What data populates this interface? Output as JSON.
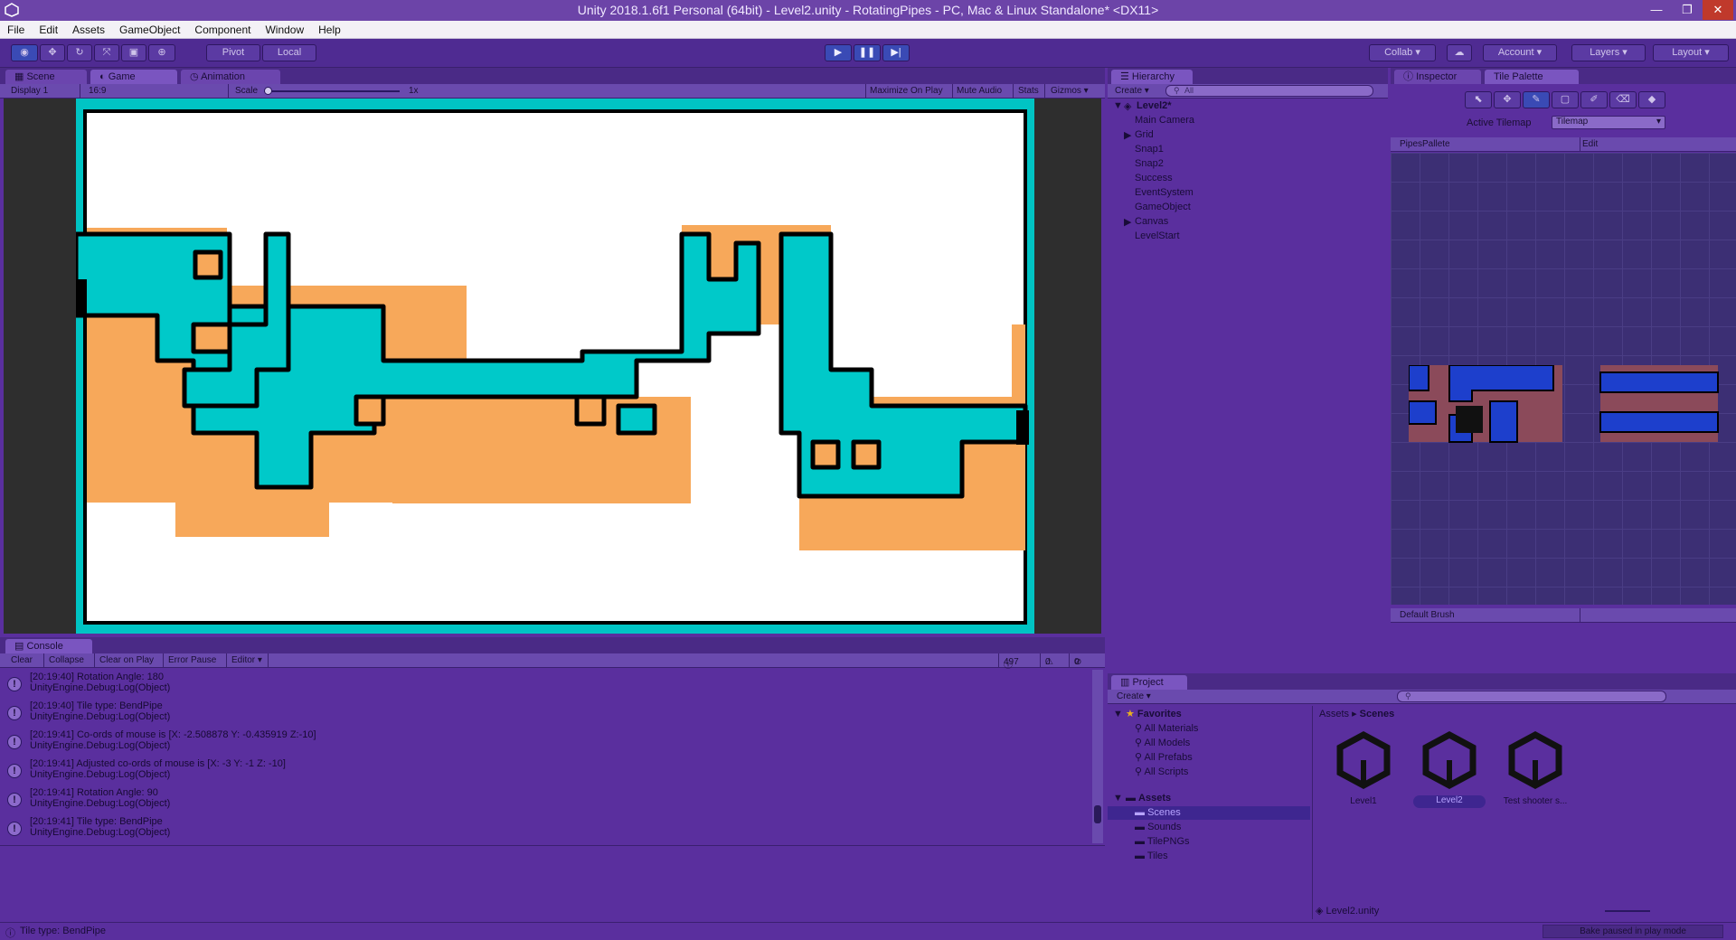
{
  "window": {
    "title": "Unity 2018.1.6f1 Personal (64bit) - Level2.unity - RotatingPipes - PC, Mac & Linux Standalone* <DX11>",
    "controls": [
      "—",
      "❐",
      "✕"
    ]
  },
  "menu": [
    "File",
    "Edit",
    "Assets",
    "GameObject",
    "Component",
    "Window",
    "Help"
  ],
  "toolbar": {
    "pivot": "Pivot",
    "local": "Local",
    "collab": "Collab ▾",
    "account": "Account",
    "layers": "Layers",
    "layout": "Layout"
  },
  "scene_tabs": {
    "tabs": [
      "Scene",
      "Game",
      "Animation"
    ],
    "active": "Game",
    "display": "Display 1",
    "aspect": "16:9",
    "scale_label": "Scale",
    "scale_value": "1x",
    "options": [
      "Maximize On Play",
      "Mute Audio",
      "Stats",
      "Gizmos ▾"
    ]
  },
  "hierarchy": {
    "tab": "Hierarchy",
    "create": "Create ▾",
    "search_placeholder": "All",
    "scene": "Level2*",
    "items": [
      "Main Camera",
      "Grid",
      "Snap1",
      "Snap2",
      "Success",
      "EventSystem",
      "GameObject",
      "Canvas",
      "LevelStart"
    ],
    "expandable": [
      "Grid",
      "Canvas"
    ]
  },
  "inspector": {
    "tabs": [
      "Inspector",
      "Tile Palette"
    ],
    "active_tilemap_label": "Active Tilemap",
    "active_tilemap_value": "Tilemap",
    "palette_name": "PipesPallete",
    "edit_label": "Edit",
    "brush": "Default Brush"
  },
  "console": {
    "tab": "Console",
    "buttons": [
      "Clear",
      "Collapse",
      "Clear on Play",
      "Error Pause",
      "Editor ▾"
    ],
    "counts": {
      "log": "497",
      "warn": "0",
      "error": "0"
    },
    "entries": [
      {
        "line1": "[20:19:40] Rotation Angle: 180",
        "line2": "UnityEngine.Debug:Log(Object)"
      },
      {
        "line1": "[20:19:40] Tile type: BendPipe",
        "line2": "UnityEngine.Debug:Log(Object)"
      },
      {
        "line1": "[20:19:41] Co-ords of mouse is [X: -2.508878 Y: -0.435919 Z:-10]",
        "line2": "UnityEngine.Debug:Log(Object)"
      },
      {
        "line1": "[20:19:41] Adjusted co-ords of mouse is [X: -3 Y: -1 Z: -10]",
        "line2": "UnityEngine.Debug:Log(Object)"
      },
      {
        "line1": "[20:19:41] Rotation Angle: 90",
        "line2": "UnityEngine.Debug:Log(Object)"
      },
      {
        "line1": "[20:19:41] Tile type: BendPipe",
        "line2": "UnityEngine.Debug:Log(Object)"
      }
    ]
  },
  "project": {
    "tab": "Project",
    "create": "Create ▾",
    "favorites_label": "Favorites",
    "favorites": [
      "All Materials",
      "All Models",
      "All Prefabs",
      "All Scripts"
    ],
    "assets_label": "Assets",
    "folders": [
      "Scenes",
      "Sounds",
      "TilePNGs",
      "Tiles"
    ],
    "selected_folder": "Scenes",
    "breadcrumb": [
      "Assets",
      "Scenes"
    ],
    "files": [
      "Level1",
      "Level2",
      "Test shooter s..."
    ],
    "selected_file": "Level2",
    "footer_path": "Level2.unity"
  },
  "status": {
    "message": "Tile type: BendPipe",
    "bake": "Bake paused in play mode"
  },
  "colors": {
    "editor_bg": "#5a2f9e",
    "pipe": "#00c9c9",
    "sand": "#f7a85a",
    "frame": "#00c4c4"
  }
}
